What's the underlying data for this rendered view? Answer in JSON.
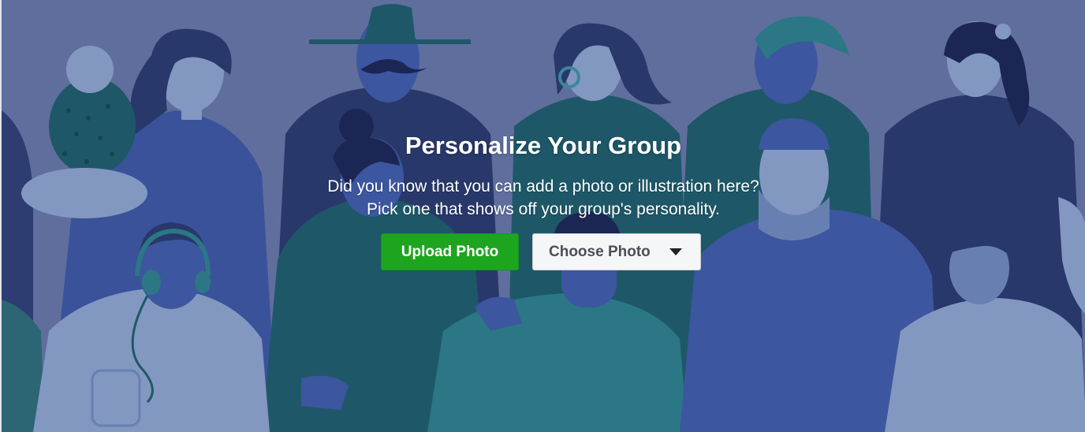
{
  "banner": {
    "title": "Personalize Your Group",
    "description_line1": "Did you know that you can add a photo or illustration here?",
    "description_line2": "Pick one that shows off your group's personality.",
    "upload_label": "Upload Photo",
    "choose_label": "Choose Photo",
    "choose_icon": "caret-down-icon"
  },
  "colors": {
    "background": "#6573a3",
    "upload_button": "#1ea51f",
    "choose_button": "#f5f6f7",
    "navy": "#2b3a6e",
    "teal": "#1f5c6b",
    "blue": "#3f5aa6",
    "sky": "#4a6fb3"
  }
}
